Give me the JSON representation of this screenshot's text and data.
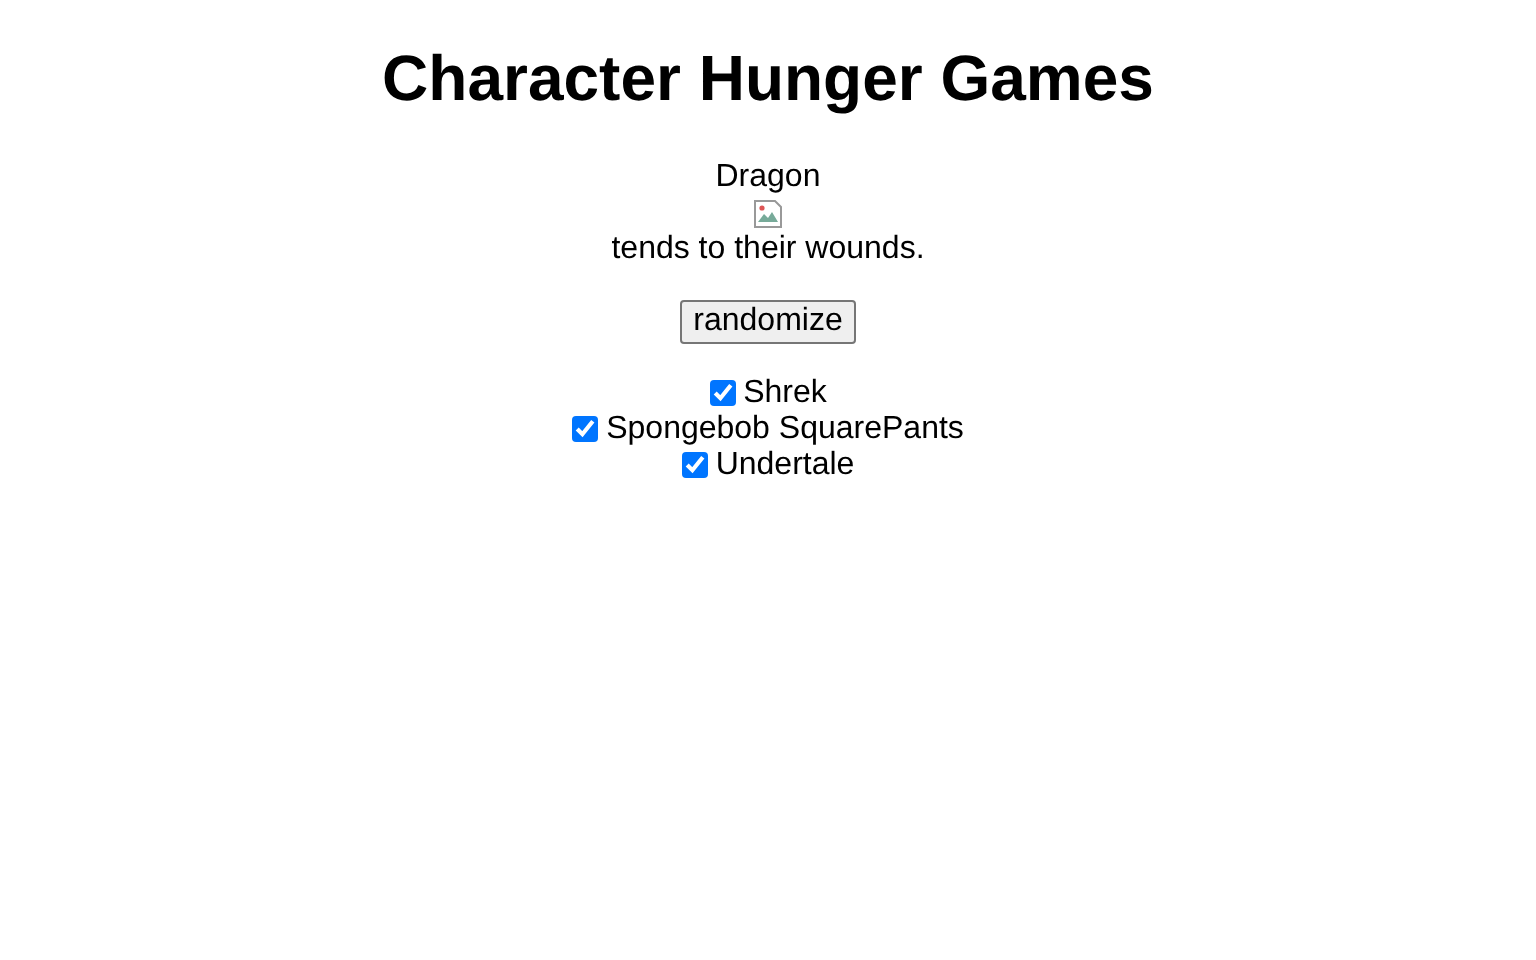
{
  "title": "Character Hunger Games",
  "event": {
    "actor": "Dragon",
    "text": "tends to their wounds."
  },
  "button": "randomize",
  "options": [
    {
      "label": "Shrek",
      "checked": true
    },
    {
      "label": "Spongebob SquarePants",
      "checked": true
    },
    {
      "label": "Undertale",
      "checked": true
    }
  ]
}
